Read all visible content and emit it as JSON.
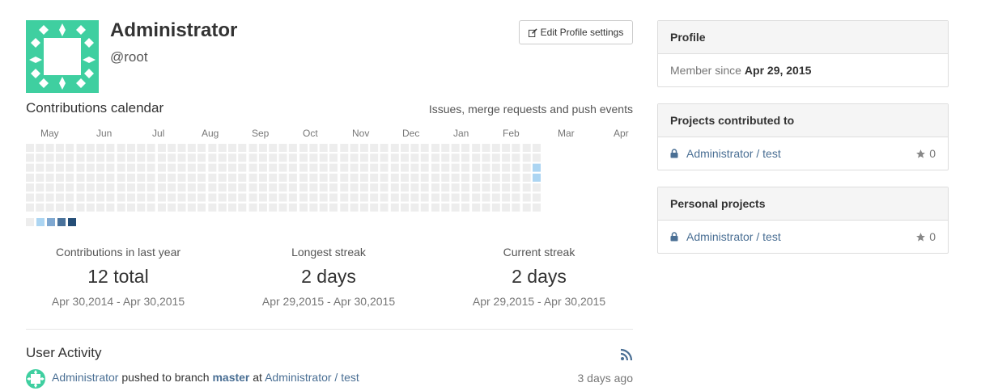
{
  "profile": {
    "name": "Administrator",
    "username": "@root",
    "edit_button": "Edit Profile settings"
  },
  "calendar": {
    "title": "Contributions calendar",
    "legend_text": "Issues, merge requests and push events",
    "months": [
      "May",
      "Jun",
      "Jul",
      "Aug",
      "Sep",
      "Oct",
      "Nov",
      "Dec",
      "Jan",
      "Feb",
      "Mar",
      "Apr"
    ],
    "colors": [
      "#ededed",
      "#acd5f2",
      "#7fa8d1",
      "#49729b",
      "#254e77"
    ]
  },
  "stats": [
    {
      "label": "Contributions in last year",
      "value": "12 total",
      "range": "Apr 30,2014 - Apr 30,2015"
    },
    {
      "label": "Longest streak",
      "value": "2 days",
      "range": "Apr 29,2015 - Apr 30,2015"
    },
    {
      "label": "Current streak",
      "value": "2 days",
      "range": "Apr 29,2015 - Apr 30,2015"
    }
  ],
  "activity": {
    "title": "User Activity",
    "author": "Administrator",
    "action": "pushed to branch",
    "branch": "master",
    "at": "at",
    "project": "Administrator / test",
    "time": "3 days ago"
  },
  "sidebar": {
    "profile": {
      "title": "Profile",
      "member_label": "Member since",
      "member_date": "Apr 29, 2015"
    },
    "contributed": {
      "title": "Projects contributed to",
      "project": "Administrator / test",
      "stars": "0"
    },
    "personal": {
      "title": "Personal projects",
      "project": "Administrator / test",
      "stars": "0"
    }
  }
}
